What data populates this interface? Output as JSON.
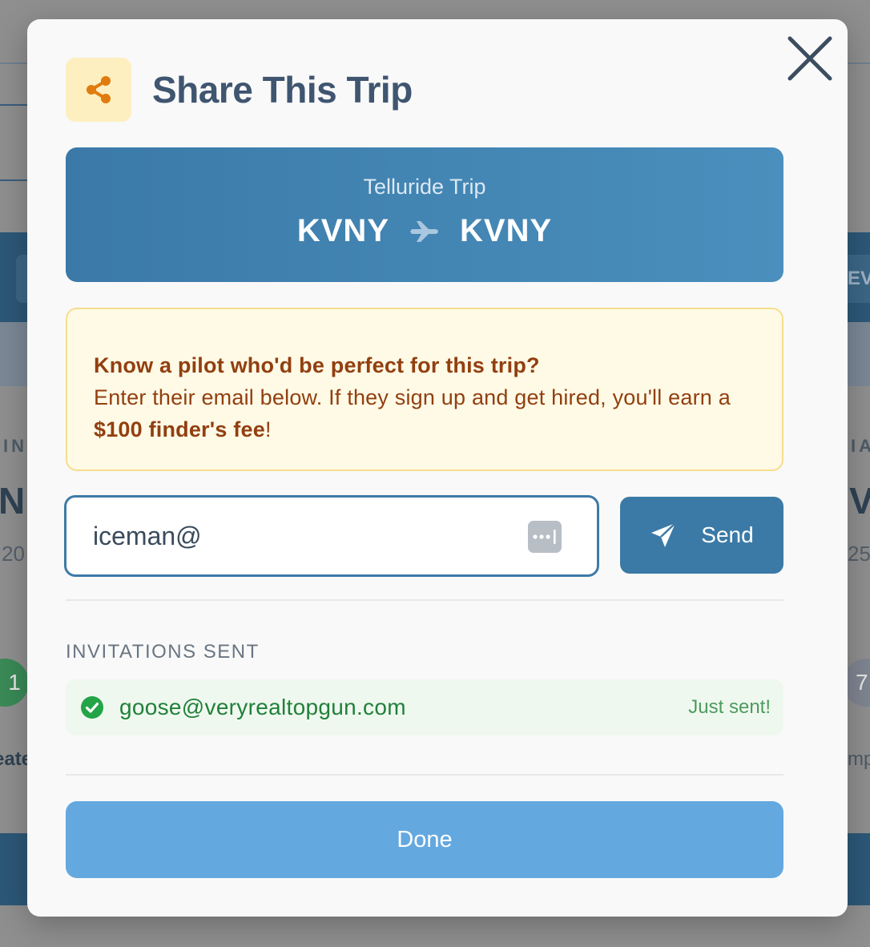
{
  "background": {
    "left_fragments": [
      "IN",
      "N",
      "20",
      "eate"
    ],
    "right_fragments": [
      "EV",
      "IA",
      "V",
      "25",
      "mp"
    ],
    "left_badge": "1",
    "right_badge": "7"
  },
  "modal": {
    "title": "Share This Trip",
    "icons": {
      "header": "share-icon",
      "close": "close-icon"
    },
    "route": {
      "trip_name": "Telluride Trip",
      "origin": "KVNY",
      "destination": "KVNY",
      "separator_icon": "airplane-icon"
    },
    "referral": {
      "headline": "Know a pilot who'd be perfect for this trip?",
      "body_prefix": "Enter their email below. If they sign up and get hired, you'll earn a ",
      "highlight": "$100 finder's fee",
      "body_suffix": "!"
    },
    "email_input": {
      "value": "iceman@",
      "icon": "password-manager-icon"
    },
    "send_button": {
      "label": "Send",
      "icon": "send-icon"
    },
    "invitations": {
      "section_label": "INVITATIONS SENT",
      "items": [
        {
          "email": "goose@veryrealtopgun.com",
          "status": "Just sent!",
          "icon": "check-circle-icon"
        }
      ]
    },
    "done_button": {
      "label": "Done"
    }
  },
  "colors": {
    "accent": "#3b7aa6",
    "done_button": "#64a8e0",
    "referral_text": "#923f10",
    "success": "#21803a",
    "share_icon": "#e07b0e"
  }
}
